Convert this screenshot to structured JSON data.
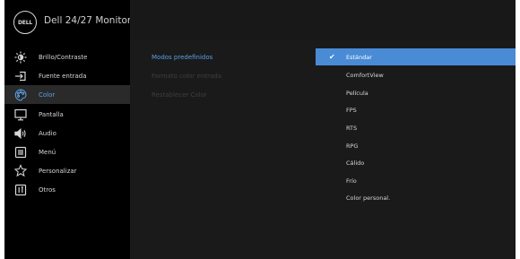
{
  "header": {
    "logo_text": "DELL",
    "title": "Dell 24/27 Monitor"
  },
  "menu": [
    {
      "label": "Brillo/Contraste",
      "icon": "brightness-icon"
    },
    {
      "label": "Fuente entrada",
      "icon": "input-source-icon"
    },
    {
      "label": "Color",
      "icon": "color-palette-icon",
      "active": true
    },
    {
      "label": "Pantalla",
      "icon": "display-icon"
    },
    {
      "label": "Audio",
      "icon": "speaker-icon"
    },
    {
      "label": "Menú",
      "icon": "menu-icon"
    },
    {
      "label": "Personalizar",
      "icon": "star-icon"
    },
    {
      "label": "Otros",
      "icon": "info-icon"
    }
  ],
  "submenu": [
    {
      "label": "Modos predefinidos",
      "state": "active"
    },
    {
      "label": "Formato color entrada",
      "state": "disabled"
    },
    {
      "label": "Restablecer Color",
      "state": "disabled"
    }
  ],
  "options": [
    {
      "label": "Estándar",
      "selected": true
    },
    {
      "label": "ComfortView"
    },
    {
      "label": "Película"
    },
    {
      "label": "FPS"
    },
    {
      "label": "RTS"
    },
    {
      "label": "RPG"
    },
    {
      "label": "Cálido"
    },
    {
      "label": "Frío"
    },
    {
      "label": "Color personal."
    }
  ],
  "colors": {
    "accent": "#4a8bd6",
    "active_text": "#5aa0e6",
    "panel": "#1a1a1a",
    "sidebar": "#000000"
  }
}
